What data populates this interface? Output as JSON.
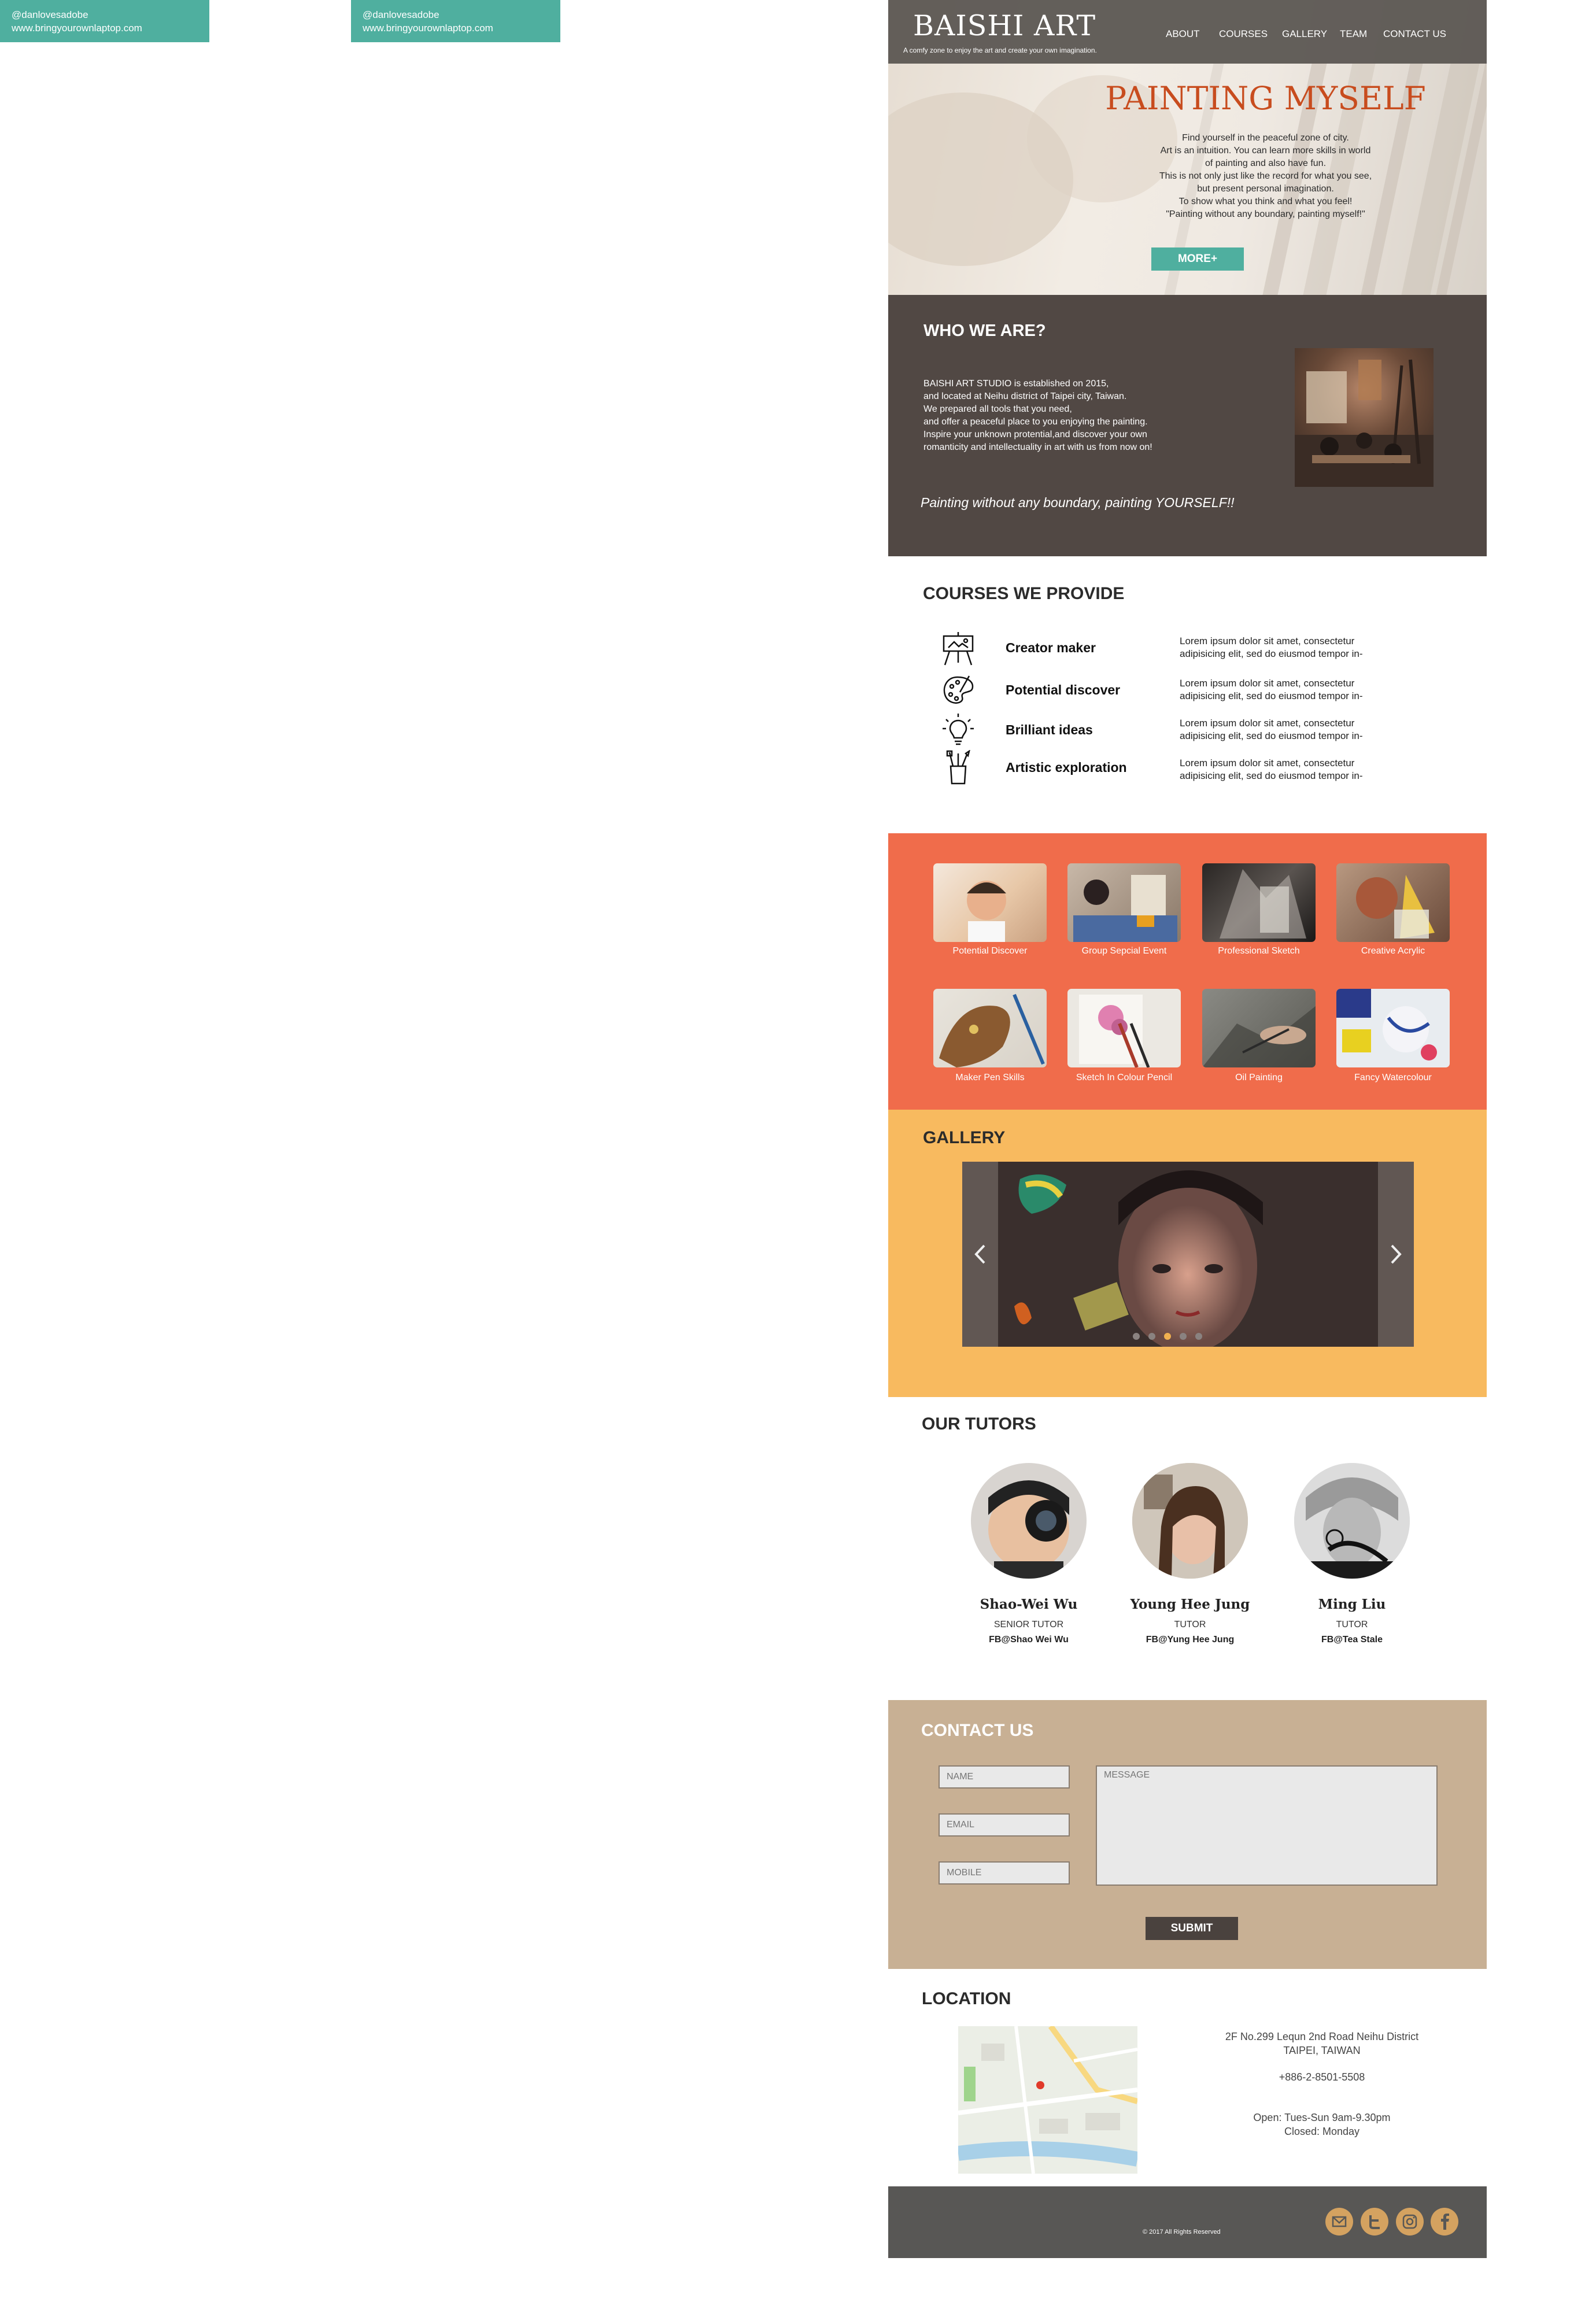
{
  "notes": [
    {
      "handle": "@danlovesadobe",
      "url": "www.bringyourownlaptop.com"
    },
    {
      "handle": "@danlovesadobe",
      "url": "www.bringyourownlaptop.com"
    }
  ],
  "header": {
    "logo": "BAISHI ART",
    "tagline": "A comfy zone to enjoy the art and create your own imagination.",
    "nav": [
      "ABOUT",
      "COURSES",
      "GALLERY",
      "TEAM",
      "CONTACT US"
    ]
  },
  "hero": {
    "title": "PAINTING MYSELF",
    "lines": [
      "Find yourself in the peaceful zone of city.",
      "Art is an intuition. You can learn more skills in world",
      "of painting and also have fun.",
      "This is not only just like the record for what you see,",
      "but present personal imagination.",
      "To show what you think and what you feel!",
      "\"Painting without any boundary, painting myself!\""
    ],
    "button": "MORE+"
  },
  "who": {
    "title": "WHO WE ARE?",
    "lines": [
      "BAISHI ART STUDIO is established on 2015,",
      "and located at Neihu district of Taipei city, Taiwan.",
      "We prepared all tools that you need,",
      "and offer a peaceful place to you enjoying the painting.",
      "Inspire your unknown protential,and discover your own",
      "romanticity and intellectuality in art with us from now on!"
    ],
    "quote": "Painting without any boundary, painting YOURSELF!!"
  },
  "courses": {
    "title": "COURSES WE PROVIDE",
    "items": [
      {
        "icon": "easel-icon",
        "name": "Creator maker",
        "desc": [
          "Lorem ipsum dolor sit amet, consectetur",
          "adipisicing elit, sed do eiusmod tempor in-"
        ]
      },
      {
        "icon": "palette-icon",
        "name": "Potential discover",
        "desc": [
          "Lorem ipsum dolor sit amet, consectetur",
          "adipisicing elit, sed do eiusmod tempor in-"
        ]
      },
      {
        "icon": "lightbulb-icon",
        "name": "Brilliant ideas",
        "desc": [
          "Lorem ipsum dolor sit amet, consectetur",
          "adipisicing elit, sed do eiusmod tempor in-"
        ]
      },
      {
        "icon": "brush-cup-icon",
        "name": "Artistic exploration",
        "desc": [
          "Lorem ipsum dolor sit amet, consectetur",
          "adipisicing elit, sed do eiusmod tempor in-"
        ]
      }
    ]
  },
  "thumbnails": [
    "Potential Discover",
    "Group Sepcial Event",
    "Professional Sketch",
    "Creative Acrylic",
    "Maker Pen Skills",
    "Sketch In Colour Pencil",
    "Oil Painting",
    "Fancy Watercolour"
  ],
  "gallery": {
    "title": "GALLERY",
    "slide_count": 5,
    "active_slide": 3
  },
  "tutors": {
    "title": "OUR TUTORS",
    "items": [
      {
        "name": "Shao-Wei Wu",
        "role": "SENIOR TUTOR",
        "fb": "FB@Shao Wei Wu"
      },
      {
        "name": "Young Hee Jung",
        "role": "TUTOR",
        "fb": "FB@Yung Hee Jung"
      },
      {
        "name": "Ming Liu",
        "role": "TUTOR",
        "fb": "FB@Tea Stale"
      }
    ]
  },
  "contact": {
    "title": "CONTACT US",
    "name_placeholder": "NAME",
    "email_placeholder": "EMAIL",
    "mobile_placeholder": "MOBILE",
    "message_placeholder": "MESSAGE",
    "submit": "SUBMIT"
  },
  "location": {
    "title": "LOCATION",
    "address": [
      "2F No.299 Lequn 2nd Road Neihu District",
      "TAIPEI, TAIWAN"
    ],
    "phone": "+886-2-8501-5508",
    "hours": [
      "Open: Tues-Sun 9am-9.30pm",
      "Closed: Monday"
    ]
  },
  "footer": {
    "copyright": "© 2017 All Rights Reserved",
    "social": [
      "mail-icon",
      "twitter-icon",
      "instagram-icon",
      "facebook-icon"
    ]
  },
  "colors": {
    "teal": "#4faf9f",
    "coral": "#f06c4b",
    "amber": "#f8ba5f",
    "sand": "#c8b094",
    "dark_brown": "#514844",
    "title_orange": "#c84c1e",
    "footer": "#585755"
  }
}
